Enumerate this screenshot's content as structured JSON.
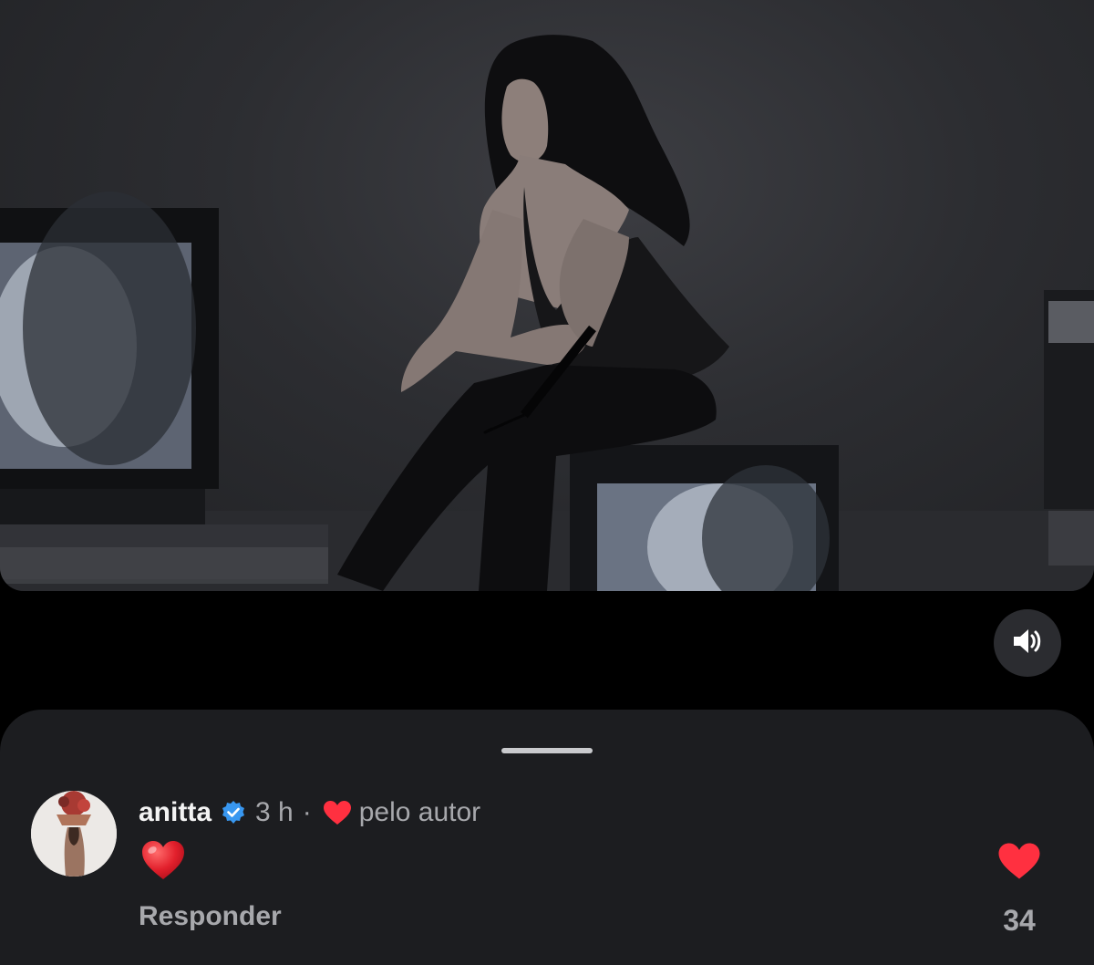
{
  "video": {
    "icon": "speaker-unmuted-icon"
  },
  "comment": {
    "username": "anitta",
    "verified_icon": "verified-badge-icon",
    "time": "3 h",
    "separator": "·",
    "author_like_icon": "heart-icon",
    "liked_by_label": "pelo autor",
    "body": "❤️",
    "reply_label": "Responder",
    "like_icon": "heart-icon",
    "like_count": "34"
  },
  "colors": {
    "background": "#000000",
    "sheet": "#1c1d20",
    "heart": "#ff3040",
    "verified": "#3897f0",
    "muted_text": "#a7a8ac"
  }
}
